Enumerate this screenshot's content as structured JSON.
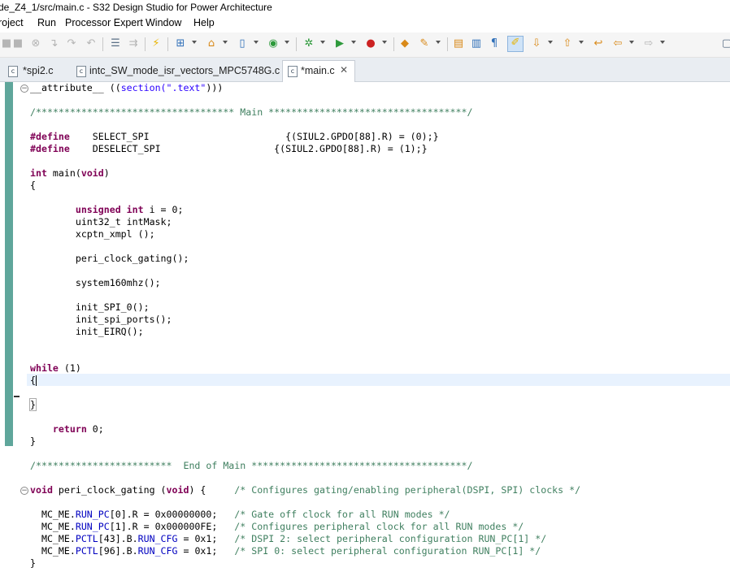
{
  "window": {
    "title": "de_Z4_1/src/main.c - S32 Design Studio for Power Architecture"
  },
  "menu": [
    "roject",
    "Run",
    "Processor Expert",
    "Window",
    "Help"
  ],
  "toolbar_icons": [
    "stop-icon",
    "terminate-all-icon",
    "disconnect-icon",
    "step-into-icon",
    "step-over-icon",
    "step-return-icon",
    "list-icon",
    "instruction-step-icon",
    "new-project-icon",
    "build-icon",
    "lightning-icon",
    "new-source-icon",
    "new-class-icon",
    "refresh-icon",
    "debug-icon",
    "run-icon",
    "external-tools-icon",
    "open-type-icon",
    "search-icon",
    "annotation-icon",
    "outline-icon",
    "paragraph-icon",
    "highlight-icon",
    "next-annotation-icon",
    "previous-annotation-icon",
    "last-edit-icon",
    "back-icon",
    "forward-icon"
  ],
  "tabs": [
    {
      "label": "*spi2.c",
      "icon": "c"
    },
    {
      "label": "intc_SW_mode_isr_vectors_MPC5748G.c",
      "icon": "c"
    },
    {
      "label": "*main.c",
      "icon": "c",
      "close": "✕"
    }
  ],
  "code": [
    {
      "s": [
        [
          "",
          "__attribute__ (("
        ],
        [
          "str",
          "section(\".text\""
        ],
        [
          "",
          ")))"
        ]
      ]
    },
    {
      "s": []
    },
    {
      "s": [
        [
          "cm",
          "/*********************************** Main ***********************************/"
        ]
      ]
    },
    {
      "s": []
    },
    {
      "s": [
        [
          "kw",
          "#define"
        ],
        [
          "",
          "    SELECT_SPI                        {(SIUL2.GPDO[88].R) = (0);}"
        ]
      ]
    },
    {
      "s": [
        [
          "kw",
          "#define"
        ],
        [
          "",
          "    DESELECT_SPI                    {(SIUL2.GPDO[88].R) = (1);}"
        ]
      ]
    },
    {
      "s": []
    },
    {
      "s": [
        [
          "kw",
          "int"
        ],
        [
          "",
          " main("
        ],
        [
          "kw",
          "void"
        ],
        [
          "",
          ")"
        ]
      ]
    },
    {
      "s": [
        [
          "",
          "{"
        ]
      ]
    },
    {
      "s": []
    },
    {
      "s": [
        [
          "",
          "        "
        ],
        [
          "kw",
          "unsigned int"
        ],
        [
          "",
          " i = 0;"
        ]
      ]
    },
    {
      "s": [
        [
          "",
          "        uint32_t intMask;"
        ]
      ]
    },
    {
      "s": [
        [
          "",
          "        xcptn_xmpl ();"
        ]
      ]
    },
    {
      "s": []
    },
    {
      "s": [
        [
          "",
          "        peri_clock_gating();"
        ]
      ]
    },
    {
      "s": []
    },
    {
      "s": [
        [
          "",
          "        system160mhz();"
        ]
      ]
    },
    {
      "s": []
    },
    {
      "s": [
        [
          "",
          "        init_SPI_0();"
        ]
      ]
    },
    {
      "s": [
        [
          "",
          "        init_spi_ports();"
        ]
      ]
    },
    {
      "s": [
        [
          "",
          "        init_EIRQ();"
        ]
      ]
    },
    {
      "s": []
    },
    {
      "s": []
    },
    {
      "s": [
        [
          "kw",
          "while"
        ],
        [
          "",
          " (1)"
        ]
      ]
    },
    {
      "s": [
        [
          "",
          "{"
        ]
      ]
    },
    {
      "s": []
    },
    {
      "s": [
        [
          "",
          "}"
        ]
      ]
    },
    {
      "s": []
    },
    {
      "s": [
        [
          "",
          "    "
        ],
        [
          "kw",
          "return"
        ],
        [
          "",
          " 0;"
        ]
      ]
    },
    {
      "s": [
        [
          "",
          "}"
        ]
      ]
    },
    {
      "s": []
    },
    {
      "s": [
        [
          "cm",
          "/************************  End of Main **************************************/"
        ]
      ]
    },
    {
      "s": []
    },
    {
      "s": [
        [
          "kw",
          "void"
        ],
        [
          "",
          " peri_clock_gating ("
        ],
        [
          "kw",
          "void"
        ],
        [
          "",
          ") {     "
        ],
        [
          "cm",
          "/* Configures gating/enabling peripheral(DSPI, SPI) clocks */"
        ]
      ]
    },
    {
      "s": []
    },
    {
      "s": [
        [
          "",
          "  MC_ME."
        ],
        [
          "fld",
          "RUN_PC"
        ],
        [
          "",
          "[0].R = 0x00000000;   "
        ],
        [
          "cm",
          "/* Gate off clock for all RUN modes */"
        ]
      ]
    },
    {
      "s": [
        [
          "",
          "  MC_ME."
        ],
        [
          "fld",
          "RUN_PC"
        ],
        [
          "",
          "[1].R = 0x000000FE;   "
        ],
        [
          "cm",
          "/* Configures peripheral clock for all RUN modes */"
        ]
      ]
    },
    {
      "s": [
        [
          "",
          "  MC_ME."
        ],
        [
          "fld",
          "PCTL"
        ],
        [
          "",
          "[43].B."
        ],
        [
          "fld",
          "RUN_CFG"
        ],
        [
          "",
          " = 0x1;   "
        ],
        [
          "cm",
          "/* DSPI 2: select peripheral configuration RUN_PC[1] */"
        ]
      ]
    },
    {
      "s": [
        [
          "",
          "  MC_ME."
        ],
        [
          "fld",
          "PCTL"
        ],
        [
          "",
          "[96].B."
        ],
        [
          "fld",
          "RUN_CFG"
        ],
        [
          "",
          " = 0x1;   "
        ],
        [
          "cm",
          "/* SPI 0: select peripheral configuration RUN_PC[1] */"
        ]
      ]
    },
    {
      "s": [
        [
          "",
          "}"
        ]
      ]
    }
  ],
  "colors": {
    "keyword": "#7f0055",
    "comment": "#3f7f5f",
    "field": "#0000c0",
    "string": "#2a00ff",
    "current_line": "#e8f2fe",
    "change_bar": "#5fa69b"
  }
}
